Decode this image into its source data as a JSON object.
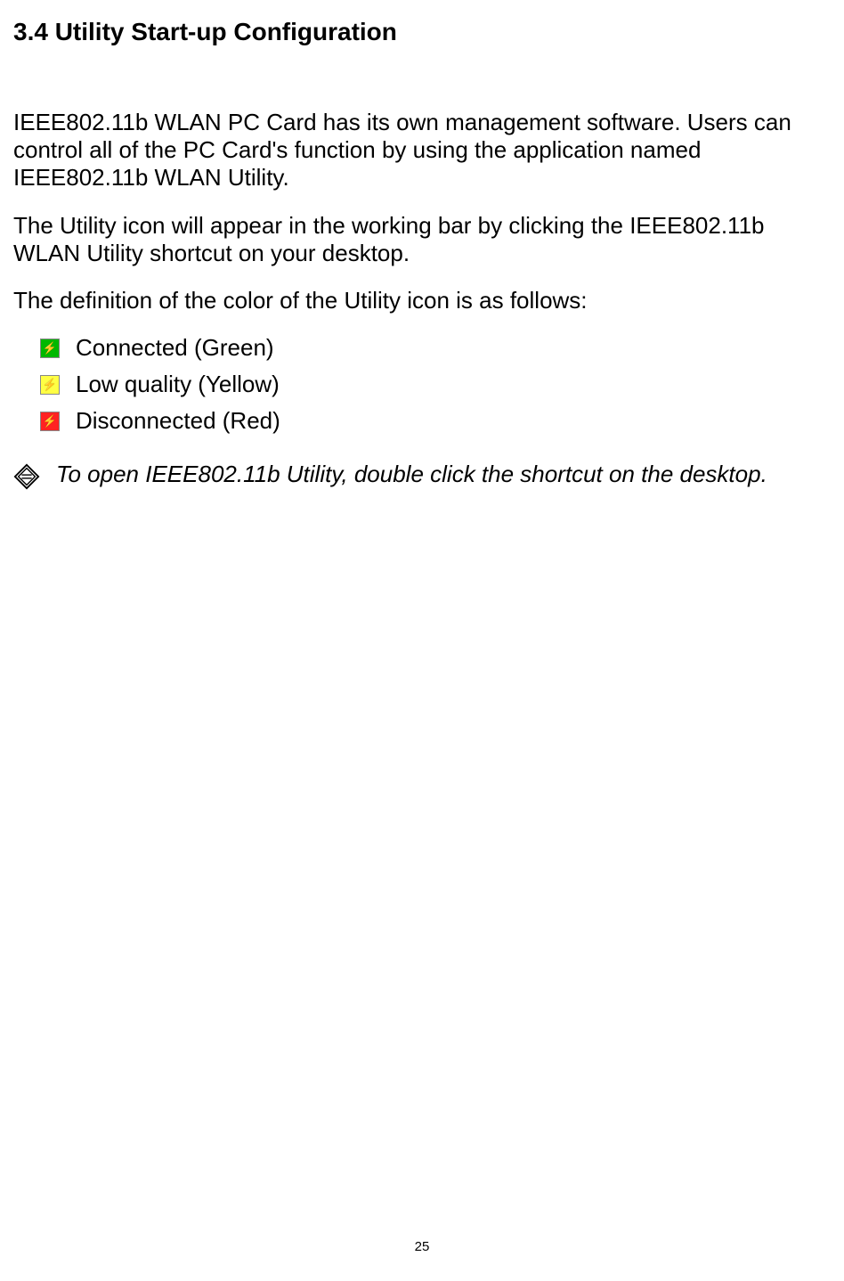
{
  "heading": "3.4 Utility Start-up Configuration",
  "para1": "IEEE802.11b WLAN PC Card has its own management software. Users can control all of the PC Card's function by using the application named IEEE802.11b WLAN Utility.",
  "para2": "The Utility icon will appear in the working bar by clicking the IEEE802.11b WLAN Utility shortcut on your desktop.",
  "para3": "The definition of the color of the Utility icon is as follows:",
  "icons": {
    "connected": "Connected (Green)",
    "low": "Low quality (Yellow)",
    "disconnected": "Disconnected (Red)"
  },
  "note": "To open IEEE802.11b Utility, double click the shortcut on the desktop.",
  "page_number": "25",
  "colors": {
    "green": "#00b800",
    "yellow": "#ffff44",
    "red": "#ff2222"
  }
}
